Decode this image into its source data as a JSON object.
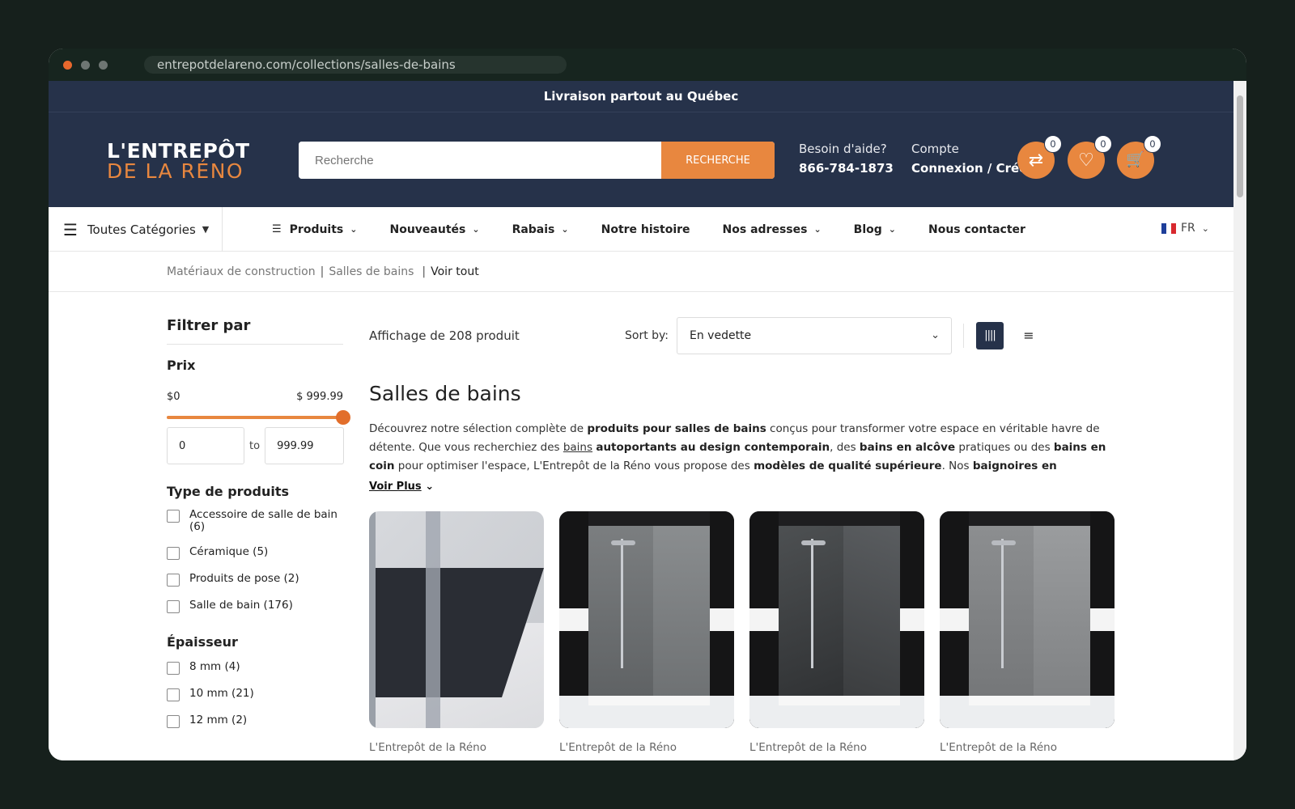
{
  "browser": {
    "url": "entrepotdelareno.com/collections/salles-de-bains",
    "dots": [
      "#e8682d",
      "#6e7673",
      "#6e7673"
    ]
  },
  "topbar": {
    "text": "Livraison partout au Québec"
  },
  "header": {
    "logo": {
      "line1": "L'ENTREPÔT",
      "line2": "DE LA RÉNO"
    },
    "search": {
      "placeholder": "Recherche",
      "button": "RECHERCHE"
    },
    "help": {
      "label": "Besoin d'aide?",
      "phone": "866-784-1873"
    },
    "account": {
      "label": "Compte",
      "link": "Connexion / Créer"
    },
    "icons": [
      {
        "name": "compare-icon",
        "glyph": "⇄",
        "count": "0"
      },
      {
        "name": "wishlist-icon",
        "glyph": "♡",
        "count": "0"
      },
      {
        "name": "cart-icon",
        "glyph": "🛒",
        "count": "0"
      }
    ]
  },
  "nav": {
    "all_categories": "Toutes Catégories",
    "items": [
      "Produits",
      "Nouveautés",
      "Rabais",
      "Notre histoire",
      "Nos adresses",
      "Blog",
      "Nous contacter"
    ],
    "has_dropdown": [
      true,
      true,
      true,
      false,
      true,
      true,
      false
    ],
    "language": "FR"
  },
  "breadcrumb": {
    "items": [
      "Matériaux de construction",
      "Salles de bains"
    ],
    "current": "Voir tout",
    "separator": "|"
  },
  "filters": {
    "title": "Filtrer par",
    "price": {
      "title": "Prix",
      "min_label": "$0",
      "max_label": "$ 999.99",
      "min_value": "0",
      "max_value": "999.99",
      "to": "to",
      "range_fraction": [
        0,
        1
      ]
    },
    "product_type": {
      "title": "Type de produits",
      "options": [
        "Accessoire de salle de bain (6)",
        "Céramique (5)",
        "Produits de pose (2)",
        "Salle de bain (176)"
      ]
    },
    "thickness": {
      "title": "Épaisseur",
      "options": [
        "8 mm (4)",
        "10 mm (21)",
        "12 mm (2)"
      ]
    }
  },
  "main": {
    "count": "Affichage de 208 produit",
    "sort_label": "Sort by:",
    "sort_value": "En vedette",
    "title": "Salles de bains",
    "description": {
      "p1": "Découvrez notre sélection complète de ",
      "b1": "produits pour salles de bains",
      "p2": " conçus pour transformer votre espace en véritable havre de détente. Que vous recherchiez des ",
      "u1": "bains",
      "p3": " ",
      "b2": "autoportants au design contemporain",
      "p4": ", des ",
      "b3": "bains en alcôve",
      "p5": " pratiques ou des ",
      "b4": "bains en coin",
      "p6": " pour optimiser l'espace, L'Entrepôt de la Réno vous propose des ",
      "b5": "modèles de qualité supérieure",
      "p7": ". Nos ",
      "b6": "baignoires en acrylique",
      "p8": "..."
    },
    "read_more": "Voir Plus",
    "products": [
      {
        "vendor": "L'Entrepôt de la Réno"
      },
      {
        "vendor": "L'Entrepôt de la Réno"
      },
      {
        "vendor": "L'Entrepôt de la Réno"
      },
      {
        "vendor": "L'Entrepôt de la Réno"
      }
    ]
  },
  "colors": {
    "navy": "#26324a",
    "accent": "#e8873f"
  }
}
